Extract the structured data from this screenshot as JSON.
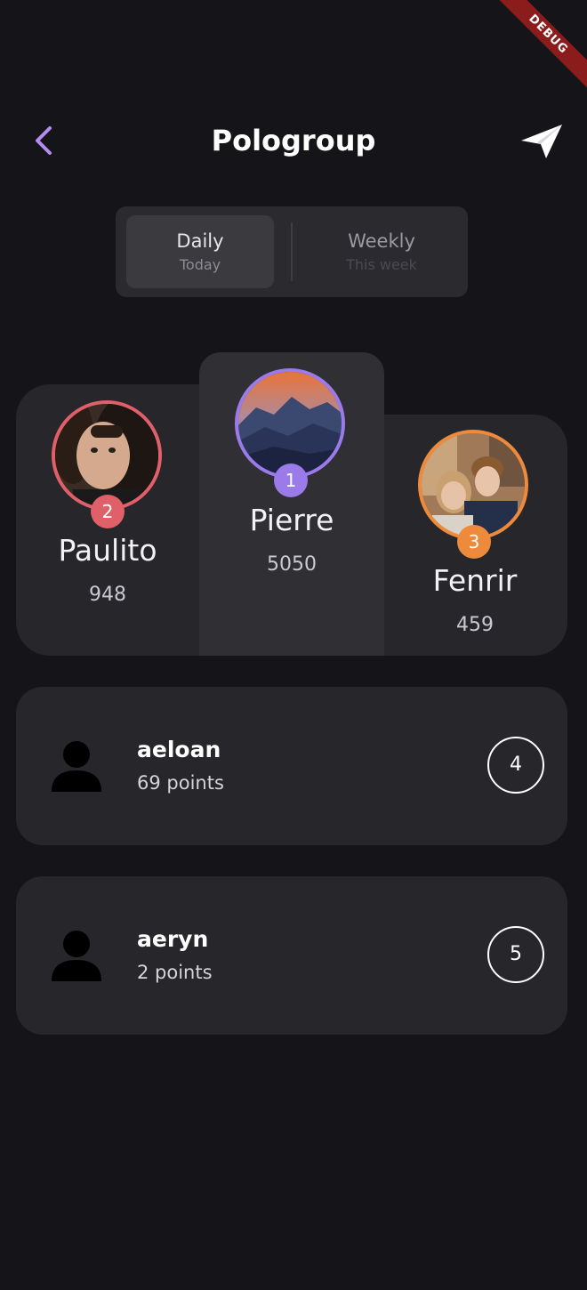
{
  "debug_banner": "DEBUG",
  "header": {
    "title": "Pologroup",
    "back_icon": "chevron-left-icon",
    "send_icon": "paper-plane-icon",
    "accent_color": "#b48cf0"
  },
  "segment": {
    "selected": "daily",
    "items": [
      {
        "label": "Daily",
        "sublabel": "Today"
      },
      {
        "label": "Weekly",
        "sublabel": "This week"
      }
    ]
  },
  "podium": [
    {
      "rank": "1",
      "name": "Pierre",
      "score": "5050",
      "ring_color": "#9b7bea",
      "avatar": "mountain-landscape"
    },
    {
      "rank": "2",
      "name": "Paulito",
      "score": "948",
      "ring_color": "#e0606a",
      "avatar": "portrait-photo"
    },
    {
      "rank": "3",
      "name": "Fenrir",
      "score": "459",
      "ring_color": "#ee8a3c",
      "avatar": "couple-photo"
    }
  ],
  "list": [
    {
      "rank": "4",
      "name": "aeloan",
      "points": "69 points",
      "icon": "person-icon"
    },
    {
      "rank": "5",
      "name": "aeryn",
      "points": "2 points",
      "icon": "person-icon"
    }
  ]
}
